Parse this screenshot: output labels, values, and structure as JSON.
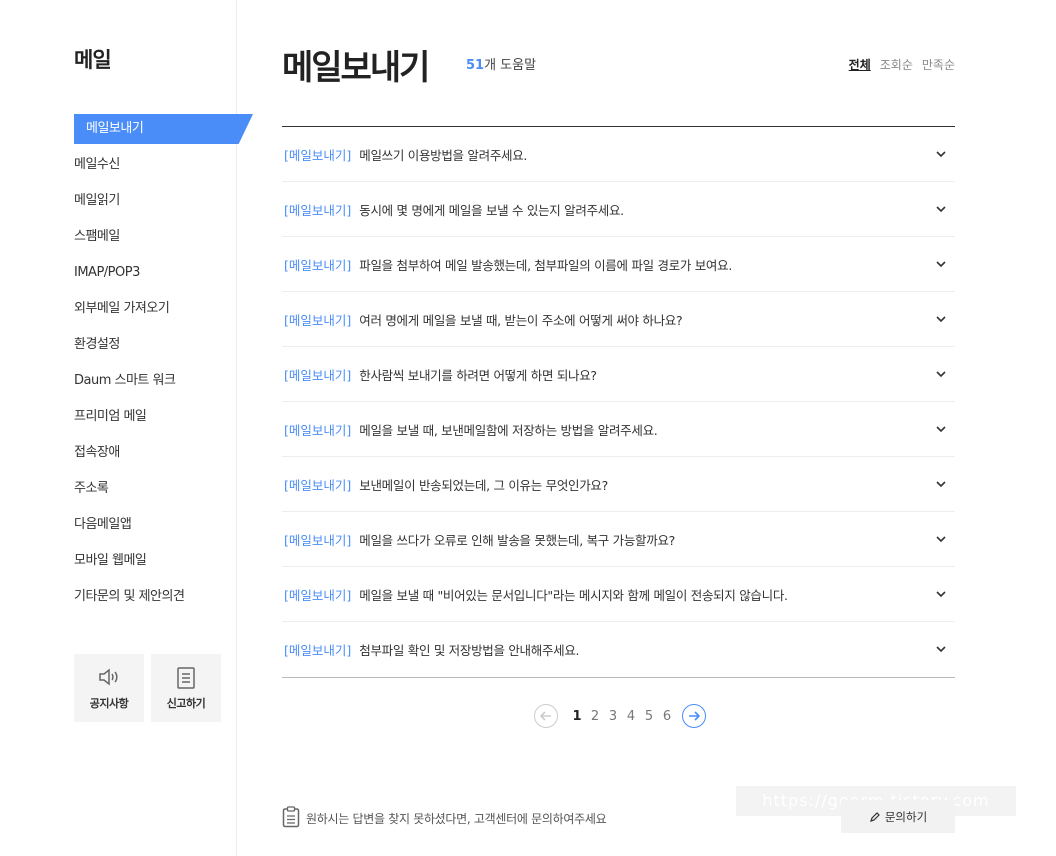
{
  "sidebar": {
    "title": "메일",
    "items": [
      {
        "label": "메일보내기",
        "active": true
      },
      {
        "label": "메일수신"
      },
      {
        "label": "메일읽기"
      },
      {
        "label": "스팸메일"
      },
      {
        "label": "IMAP/POP3"
      },
      {
        "label": "외부메일 가져오기"
      },
      {
        "label": "환경설정"
      },
      {
        "label": "Daum 스마트 워크"
      },
      {
        "label": "프리미엄 메일"
      },
      {
        "label": "접속장애"
      },
      {
        "label": "주소록"
      },
      {
        "label": "다음메일앱"
      },
      {
        "label": "모바일 웹메일"
      },
      {
        "label": "기타문의 및 제안의견"
      }
    ],
    "notice_label": "공지사항",
    "report_label": "신고하기"
  },
  "header": {
    "title": "메일보내기",
    "count": "51",
    "count_suffix": "개 도움말",
    "sort": [
      "전체",
      "조회순",
      "만족순"
    ]
  },
  "faq": [
    {
      "category": "[메일보내기]",
      "question": "메일쓰기 이용방법을 알려주세요."
    },
    {
      "category": "[메일보내기]",
      "question": "동시에 몇 명에게 메일을 보낼 수 있는지 알려주세요."
    },
    {
      "category": "[메일보내기]",
      "question": "파일을 첨부하여 메일 발송했는데, 첨부파일의 이름에 파일 경로가 보여요."
    },
    {
      "category": "[메일보내기]",
      "question": "여러 명에게 메일을 보낼 때, 받는이 주소에 어떻게 써야 하나요?"
    },
    {
      "category": "[메일보내기]",
      "question": "한사람씩 보내기를 하려면 어떻게 하면 되나요?"
    },
    {
      "category": "[메일보내기]",
      "question": "메일을 보낼 때, 보낸메일함에 저장하는 방법을 알려주세요."
    },
    {
      "category": "[메일보내기]",
      "question": "보낸메일이 반송되었는데, 그 이유는 무엇인가요?"
    },
    {
      "category": "[메일보내기]",
      "question": "메일을 쓰다가 오류로 인해 발송을 못했는데, 복구 가능할까요?"
    },
    {
      "category": "[메일보내기]",
      "question": "메일을 보낼 때 \"비어있는 문서입니다\"라는 메시지와 함께 메일이 전송되지 않습니다."
    },
    {
      "category": "[메일보내기]",
      "question": "첨부파일 확인 및 저장방법을 안내해주세요."
    }
  ],
  "pagination": {
    "pages": [
      "1",
      "2",
      "3",
      "4",
      "5",
      "6"
    ],
    "current": "1"
  },
  "footer": {
    "note": "원하시는 답변을 찾지 못하셨다면, 고객센터에 문의하여주세요",
    "contact_label": "문의하기"
  },
  "watermark": "https://goorm.tistory.com",
  "colors": {
    "accent": "#4a8df8"
  }
}
